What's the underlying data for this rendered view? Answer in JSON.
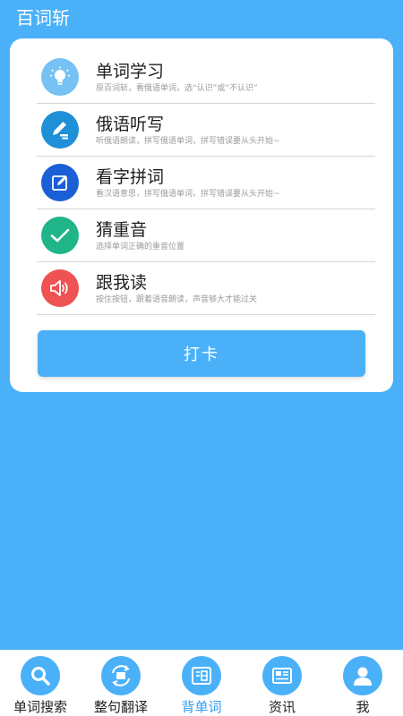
{
  "app": {
    "title": "百词斩"
  },
  "menu": {
    "items": [
      {
        "title": "单词学习",
        "desc": "原百词斩，看俄语单词，选“认识”或“不认识”",
        "icon": "lightbulb-icon",
        "color": "#76c2f4"
      },
      {
        "title": "俄语听写",
        "desc": "听俄语朗读，拼写俄语单词，拼写错误要从头开始~",
        "icon": "pencil-icon",
        "color": "#1f8fd8"
      },
      {
        "title": "看字拼词",
        "desc": "看汉语意思，拼写俄语单词，拼写错误要从头开始~",
        "icon": "edit-icon",
        "color": "#1a5fd6"
      },
      {
        "title": "猜重音",
        "desc": "选择单词正确的重音位置",
        "icon": "checkmark-icon",
        "color": "#20b489"
      },
      {
        "title": "跟我读",
        "desc": "按住按钮，跟着语音朗读，声音够大才能过关",
        "icon": "speaker-icon",
        "color": "#ee5253"
      }
    ]
  },
  "checkin": {
    "label": "打卡"
  },
  "nav": {
    "active_color": "#2f9ef0",
    "items": [
      {
        "label": "单词搜索",
        "icon": "search-icon"
      },
      {
        "label": "整句翻译",
        "icon": "translate-icon"
      },
      {
        "label": "背单词",
        "icon": "word-icon",
        "active": true
      },
      {
        "label": "资讯",
        "icon": "news-icon"
      },
      {
        "label": "我",
        "icon": "user-icon"
      }
    ]
  }
}
